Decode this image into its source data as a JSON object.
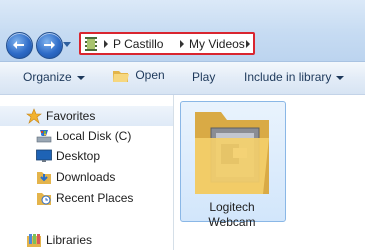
{
  "breadcrumb": [
    "P Castillo",
    "My Videos"
  ],
  "toolbar": {
    "organize": "Organize",
    "open": "Open",
    "play": "Play",
    "include_in_library": "Include in library"
  },
  "nav": {
    "favorites": "Favorites",
    "items": [
      "Local Disk (C)",
      "Desktop",
      "Downloads",
      "Recent Places"
    ],
    "libraries": "Libraries"
  },
  "file": {
    "name_line1": "Logitech",
    "name_line2": "Webcam"
  },
  "colors": {
    "address_highlight": "#d9252f",
    "nav_button": "#2e6bc7",
    "folder": "#f3d27a",
    "selection": "#d2e6fb"
  }
}
